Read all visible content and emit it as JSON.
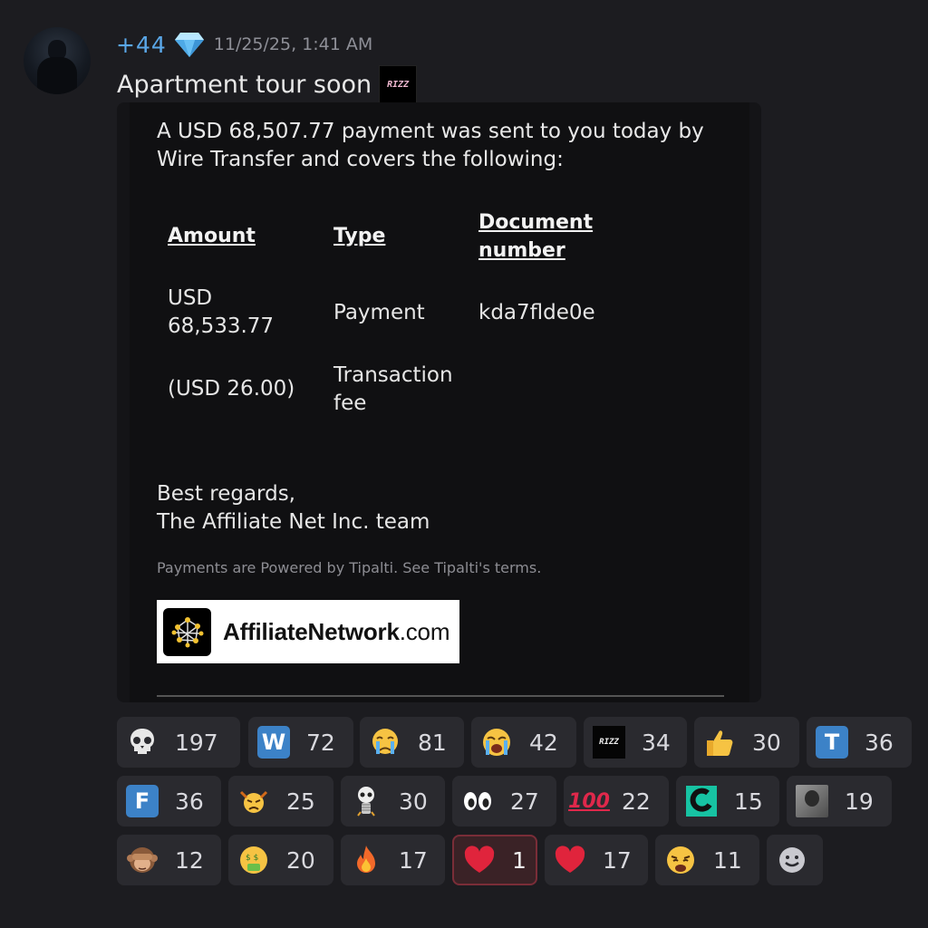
{
  "message": {
    "username": "+44",
    "timestamp": "11/25/25, 1:41 AM",
    "text": "Apartment tour soon",
    "inline_emoji_label": "RIZZ"
  },
  "embed": {
    "intro": "A USD 68,507.77 payment was sent to you today by Wire Transfer and covers the following:",
    "table": {
      "headers": [
        "Amount",
        "Type",
        "Document number"
      ],
      "rows": [
        [
          "USD 68,533.77",
          "Payment",
          "kda7flde0e"
        ],
        [
          "(USD 26.00)",
          "Transaction fee",
          ""
        ]
      ]
    },
    "regards_line1": "Best regards,",
    "regards_line2": "The Affiliate Net Inc. team",
    "footnote": "Payments are Powered by Tipalti. See Tipalti's terms.",
    "banner_text_bold": "AffiliateNetwork",
    "banner_text_light": ".com"
  },
  "reactions": [
    {
      "icon": "skull-icon",
      "count": "197"
    },
    {
      "icon": "letter-w-icon",
      "letter": "W",
      "count": "72"
    },
    {
      "icon": "crying-face-icon",
      "count": "81"
    },
    {
      "icon": "loudly-crying-face-icon",
      "count": "42"
    },
    {
      "icon": "rizz-icon",
      "label": "RIZZ",
      "count": "34"
    },
    {
      "icon": "thumbs-up-icon",
      "count": "30"
    },
    {
      "icon": "letter-t-icon",
      "letter": "T",
      "count": "36"
    },
    {
      "icon": "letter-f-icon",
      "letter": "F",
      "count": "36"
    },
    {
      "icon": "angry-face-icon",
      "count": "25"
    },
    {
      "icon": "skull-figure-icon",
      "count": "30"
    },
    {
      "icon": "eyes-icon",
      "count": "27"
    },
    {
      "icon": "hundred-points-icon",
      "label": "100",
      "count": "22"
    },
    {
      "icon": "custom-green-icon",
      "count": "15"
    },
    {
      "icon": "person-photo-icon",
      "count": "19"
    },
    {
      "icon": "see-no-evil-monkey-icon",
      "count": "12"
    },
    {
      "icon": "money-mouth-face-icon",
      "count": "20"
    },
    {
      "icon": "fire-icon",
      "count": "17"
    },
    {
      "icon": "red-heart-icon",
      "count": "1",
      "active": true
    },
    {
      "icon": "red-heart-icon",
      "count": "17"
    },
    {
      "icon": "weary-face-icon",
      "count": "11"
    },
    {
      "icon": "add-reaction-icon",
      "count": ""
    }
  ],
  "colors": {
    "background": "#1c1c20",
    "username": "#5aa7e8",
    "timestamp": "#8e8f97",
    "reaction_bg": "#2a2a2f",
    "reaction_active_border": "#7a2d38",
    "letter_box": "#3c82c7"
  }
}
